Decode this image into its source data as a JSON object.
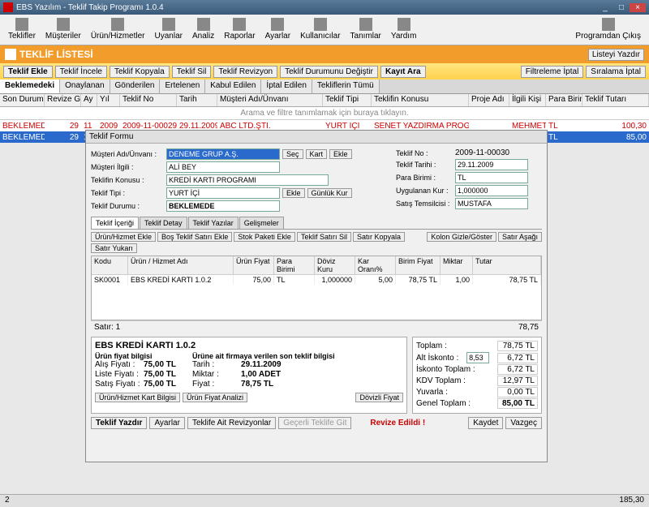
{
  "title": "EBS Yazılım - Teklif Takip Programı 1.0.4",
  "toolbar": [
    "Teklifler",
    "Müşteriler",
    "Ürün/Hizmetler",
    "Uyanlar",
    "Analiz",
    "Raporlar",
    "Ayarlar",
    "Kullanıcılar",
    "Tanımlar",
    "Yardım"
  ],
  "toolbar_right": "Programdan Çıkış",
  "header": {
    "title": "TEKLİF LİSTESİ",
    "print": "Listeyi Yazdır"
  },
  "actions": [
    "Teklif Ekle",
    "Teklif İncele",
    "Teklif Kopyala",
    "Teklif Sil",
    "Teklif Revizyon",
    "Teklif Durumunu Değiştir",
    "Kayıt Ara"
  ],
  "actions_right": [
    "Filtreleme İptal",
    "Sıralama İptal"
  ],
  "filtertabs": [
    "Beklemedeki",
    "Onaylanan",
    "Gönderilen",
    "Ertelenen",
    "Kabul Edilen",
    "İptal Edilen",
    "Tekliflerin Tümü"
  ],
  "gridcols": [
    "Son Durum",
    "Revize Gün",
    "Ay",
    "Yıl",
    "Teklif No",
    "Tarih",
    "Müşteri Adı/Ünvanı",
    "Teklif Tipi",
    "Teklifin Konusu",
    "Proje Adı",
    "İlgili Kişi",
    "Para Birimi",
    "Teklif Tutarı"
  ],
  "filtertext": "Arama ve filtre tanımlamak için buraya tıklayın.",
  "rows": [
    {
      "durum": "BEKLEMEDE",
      "gun": "29",
      "ay": "11",
      "yil": "2009",
      "no": "2009-11-00029",
      "tarih": "29.11.2009",
      "musteri": "ABC LTD.ŞTİ.",
      "tip": "YURT İÇİ",
      "konu": "SENET YAZDIRMA PROGRAMI",
      "kisi": "MEHMET",
      "tutar": "100,30"
    },
    {
      "durum": "BEKLEMEDE",
      "gun": "29",
      "ay": "11",
      "yil": "2009",
      "no": "2009-11-00030",
      "tarih": "29.11.2009",
      "musteri": "DENEME GRUP A.Ş.",
      "tip": "YURT İÇİ",
      "konu": "KREDİ KARTI PROGRAMI",
      "kisi": "ALİ BEY",
      "tutar": "85,00"
    }
  ],
  "form": {
    "title": "Teklif Formu",
    "labels": {
      "musteri": "Müşteri Adı/Ünvanı :",
      "ilgili": "Müşteri İlgili :",
      "konu": "Teklifin Konusu :",
      "tip": "Teklif Tipi :",
      "durum": "Teklif Durumu :",
      "no": "Teklif No :",
      "tarih": "Teklif Tarihi :",
      "para": "Para Birimi :",
      "kur": "Uygulanan Kur :",
      "temsilci": "Satış Temsilcisi :"
    },
    "vals": {
      "musteri": "DENEME GRUP A.Ş.",
      "ilgili": "ALİ BEY",
      "konu": "KREDİ KARTI PROGRAMI",
      "tip": "YURT İÇİ",
      "durum": "BEKLEMEDE",
      "no": "2009-11-00030",
      "tarih": "29.11.2009",
      "para": "TL",
      "kur": "1,000000",
      "temsilci": "MUSTAFA"
    },
    "btns": {
      "sec": "Seç",
      "kart": "Kart",
      "ekle": "Ekle",
      "ekle2": "Ekle",
      "gunluk": "Günlük Kur"
    },
    "itabs": [
      "Teklif İçeriği",
      "Teklif Detay",
      "Teklif Yazılar",
      "Gelişmeler"
    ],
    "ibtns": [
      "Ürün/Hizmet Ekle",
      "Boş Teklif Satırı Ekle",
      "Stok Paketi Ekle",
      "Teklif Satırı Sil",
      "Satır Kopyala"
    ],
    "ibtns2": [
      "Kolon Gizle/Göster",
      "Satır Aşağı",
      "Satır Yukarı"
    ],
    "icols": [
      "Kodu",
      "Ürün / Hizmet Adı",
      "Ürün Fiyat",
      "Para Birimi",
      "Döviz Kuru",
      "Kar Oranı%",
      "Birim Fiyat",
      "Miktar",
      "Tutar"
    ],
    "irow": {
      "kod": "SK0001",
      "ad": "EBS KREDİ KARTI 1.0.2",
      "fiyat": "75,00",
      "para": "TL",
      "kur": "1,000000",
      "kar": "5,00",
      "birim": "78,75 TL",
      "miktar": "1,00",
      "tutar": "78,75 TL"
    },
    "stat": {
      "l": "Satır: 1",
      "r": "78,75"
    },
    "sum": {
      "title": "EBS KREDİ KARTI 1.0.2",
      "sub": "Ürün fiyat bilgisi",
      "alis": "Alış Fiyatı :",
      "alisv": "75,00  TL",
      "liste": "Liste Fiyatı :",
      "listev": "75,00  TL",
      "satis": "Satış Fiyatı :",
      "satisv": "75,00  TL",
      "sub2": "Ürüne ait firmaya  verilen son teklif bilgisi",
      "tarih": "Tarih :",
      "tarihv": "29.11.2009",
      "miktar": "Miktar :",
      "miktarv": "1,00  ADET",
      "fiyat": "Fiyat :",
      "fiyatv": "78,75  TL",
      "b1": "Ürün/Hizmet Kart Bilgisi",
      "b2": "Ürün Fiyat Analizi",
      "b3": "Dövizli Fiyat"
    },
    "tot": {
      "toplam": "Toplam :",
      "toplamv": "78,75 TL",
      "isk": "Alt İskonto :",
      "iskn": "8,53",
      "iskv": "6,72 TL",
      "iskt": "İskonto Toplam :",
      "isktv": "6,72 TL",
      "kdv": "KDV Toplam :",
      "kdvv": "12,97 TL",
      "yuv": "Yuvarla :",
      "yuvv": "0,00 TL",
      "gen": "Genel Toplam :",
      "genv": "85,00 TL"
    },
    "fbtns": {
      "yazdir": "Teklif Yazdır",
      "ayar": "Ayarlar",
      "rev": "Teklife Ait Revizyonlar",
      "git": "Geçerli Teklife Git",
      "revize": "Revize Edildi !",
      "kaydet": "Kaydet",
      "vazgec": "Vazgeç"
    }
  },
  "status": {
    "l": "2",
    "r": "185,30"
  }
}
